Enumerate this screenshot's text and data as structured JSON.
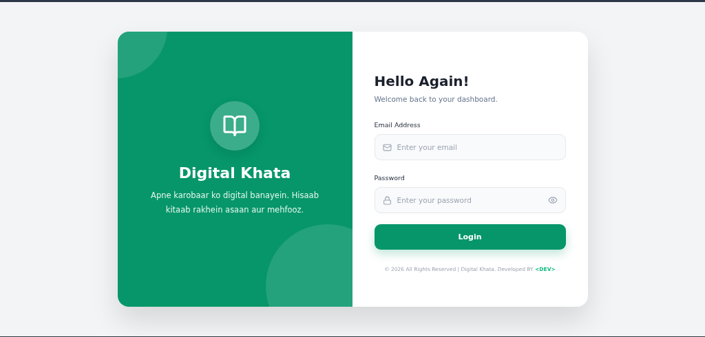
{
  "brand": {
    "title": "Digital Khata",
    "tagline": "Apne karobaar ko digital banayein. Hisaab kitaab rakhein asaan aur mehfooz."
  },
  "form": {
    "heading": "Hello Again!",
    "subheading": "Welcome back to your dashboard.",
    "fields": [
      {
        "kind": "email",
        "label": "Email Address",
        "placeholder": "Enter your email"
      },
      {
        "kind": "password",
        "label": "Password",
        "placeholder": "Enter your password"
      }
    ],
    "submit": "Login"
  },
  "footer": {
    "text": "© 2026 All Rights Reserved | Digital Khata. Developed BY",
    "link": "<DEV>"
  }
}
